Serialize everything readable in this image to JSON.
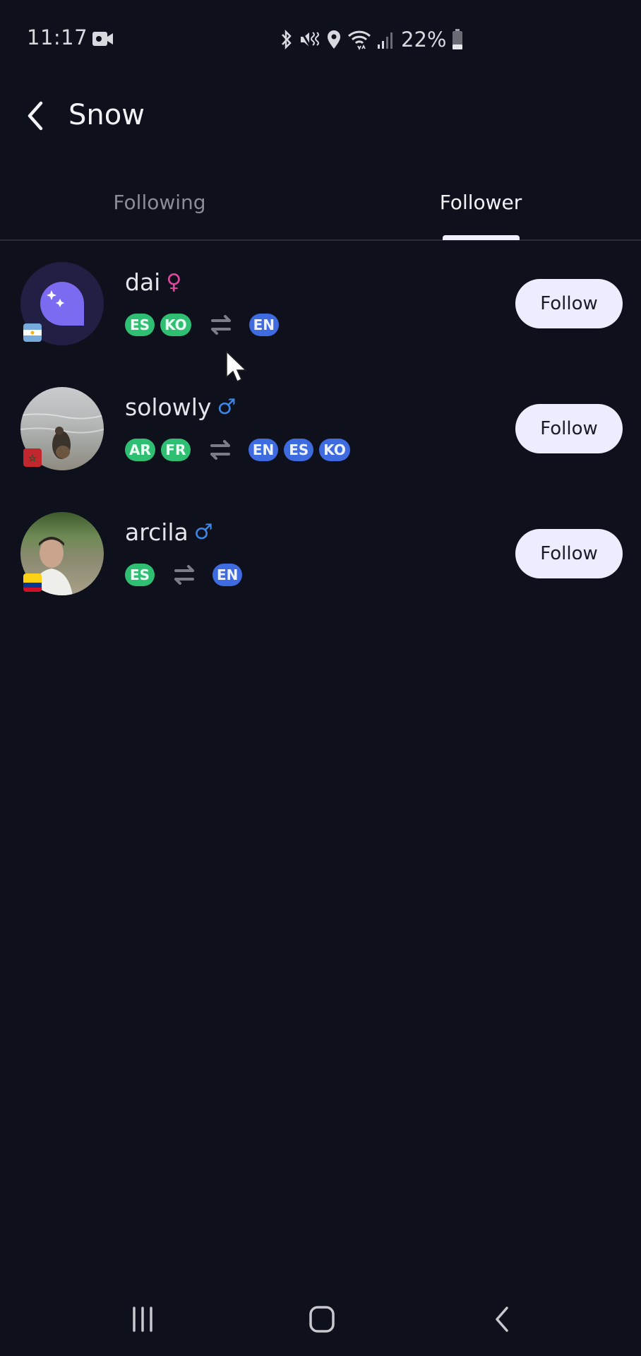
{
  "status_bar": {
    "time": "11:17",
    "battery_percent": "22%",
    "icons": [
      "video-camera-icon",
      "bluetooth-icon",
      "mute-vibrate-icon",
      "location-icon",
      "wifi-icon",
      "signal-icon",
      "battery-icon"
    ]
  },
  "header": {
    "back_icon": "chevron-left-icon",
    "title": "Snow"
  },
  "tabs": [
    {
      "label": "Following",
      "active": false
    },
    {
      "label": "Follower",
      "active": true
    }
  ],
  "followers": [
    {
      "name": "dai",
      "gender": "female",
      "gender_symbol": "♀",
      "gender_color": "#e0479e",
      "flag": "argentina",
      "avatar": "default-speech-bubble",
      "native_languages": [
        "ES",
        "KO"
      ],
      "learning_languages": [
        "EN"
      ],
      "button_label": "Follow"
    },
    {
      "name": "solowly",
      "gender": "male",
      "gender_symbol": "♂",
      "gender_color": "#3b86e6",
      "flag": "morocco",
      "avatar": "photo-beach",
      "native_languages": [
        "AR",
        "FR"
      ],
      "learning_languages": [
        "EN",
        "ES",
        "KO"
      ],
      "button_label": "Follow"
    },
    {
      "name": "arcila",
      "gender": "male",
      "gender_symbol": "♂",
      "gender_color": "#3b86e6",
      "flag": "colombia",
      "avatar": "photo-portrait",
      "native_languages": [
        "ES"
      ],
      "learning_languages": [
        "EN"
      ],
      "button_label": "Follow"
    }
  ],
  "colors": {
    "background": "#0e111c",
    "native_badge": "#2fbf73",
    "learning_badge": "#3f6be0",
    "follow_button": "#eceeff",
    "avatar_default": "#7b6bf0"
  },
  "nav_bar": {
    "icons": [
      "recent-apps-icon",
      "home-icon",
      "back-icon"
    ]
  }
}
